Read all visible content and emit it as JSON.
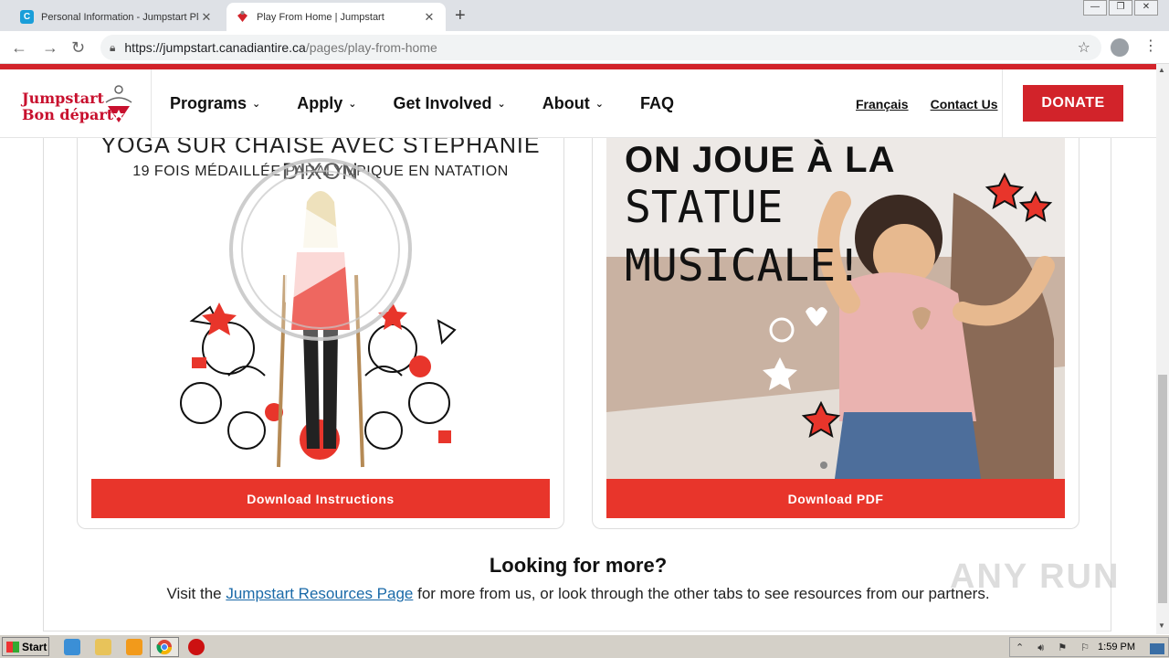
{
  "browser": {
    "tabs": [
      {
        "title": "Personal Information - Jumpstart Pla",
        "favicon": "C",
        "active": false
      },
      {
        "title": "Play From Home | Jumpstart",
        "active": true
      }
    ],
    "url_host": "https://jumpstart.canadiantire.ca",
    "url_path": "/pages/play-from-home"
  },
  "site": {
    "logo_line1": "Jumpstart",
    "logo_line2": "Bon départ",
    "nav": [
      {
        "label": "Programs",
        "dropdown": true
      },
      {
        "label": "Apply",
        "dropdown": true
      },
      {
        "label": "Get Involved",
        "dropdown": true
      },
      {
        "label": "About",
        "dropdown": true
      },
      {
        "label": "FAQ",
        "dropdown": false
      }
    ],
    "util": {
      "francais": "Français",
      "contact": "Contact Us"
    },
    "donate": "DONATE",
    "brand_red": "#d2232a",
    "button_red": "#e8352b",
    "link_blue": "#1a6aa8"
  },
  "cards": {
    "left": {
      "title_line1": "YOGA SUR CHAISE AVEC STÉPHANIE DIXON",
      "title_line2": "19 FOIS MÉDAILLÉE PARALYMPIQUE EN NATATION",
      "button": "Download Instructions"
    },
    "right": {
      "line1": "ON JOUE À LA",
      "line2": "STATUE",
      "line3": "MUSICALE!",
      "button": "Download PDF"
    }
  },
  "more": {
    "heading": "Looking for more?",
    "text_before": "Visit the ",
    "link": "Jumpstart Resources Page",
    "text_after": " for more from us, or look through the other tabs to see resources from our partners."
  },
  "watermark": "ANY RUN",
  "taskbar": {
    "start": "Start",
    "clock": "1:59 PM"
  }
}
